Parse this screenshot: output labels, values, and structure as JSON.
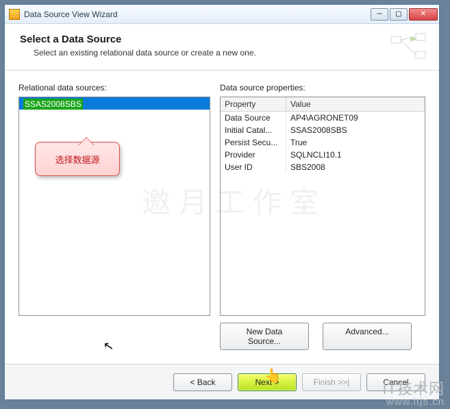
{
  "window": {
    "title": "Data Source View Wizard"
  },
  "header": {
    "title": "Select a Data Source",
    "subtitle": "Select an existing relational data source or create a new one."
  },
  "left": {
    "label": "Relational data sources:",
    "selected_item": "SSAS2008SBS"
  },
  "right": {
    "label": "Data source properties:",
    "columns": {
      "c1": "Property",
      "c2": "Value"
    },
    "rows": [
      {
        "prop": "Data Source",
        "val": "AP4\\AGRONET09"
      },
      {
        "prop": "Initial Catal...",
        "val": "SSAS2008SBS"
      },
      {
        "prop": "Persist Secu...",
        "val": "True"
      },
      {
        "prop": "Provider",
        "val": "SQLNCLI10.1"
      },
      {
        "prop": "User ID",
        "val": "SBS2008"
      }
    ]
  },
  "buttons": {
    "new_ds": "New Data Source...",
    "advanced": "Advanced..."
  },
  "nav": {
    "back": "< Back",
    "next": "Next >",
    "finish": "Finish >>|",
    "cancel": "Cancel"
  },
  "callout": {
    "text": "选择数据源"
  },
  "watermark": {
    "line1": "IT技术网",
    "line2": "www.itjs.cn"
  },
  "bg_watermark": "邀月工作室"
}
